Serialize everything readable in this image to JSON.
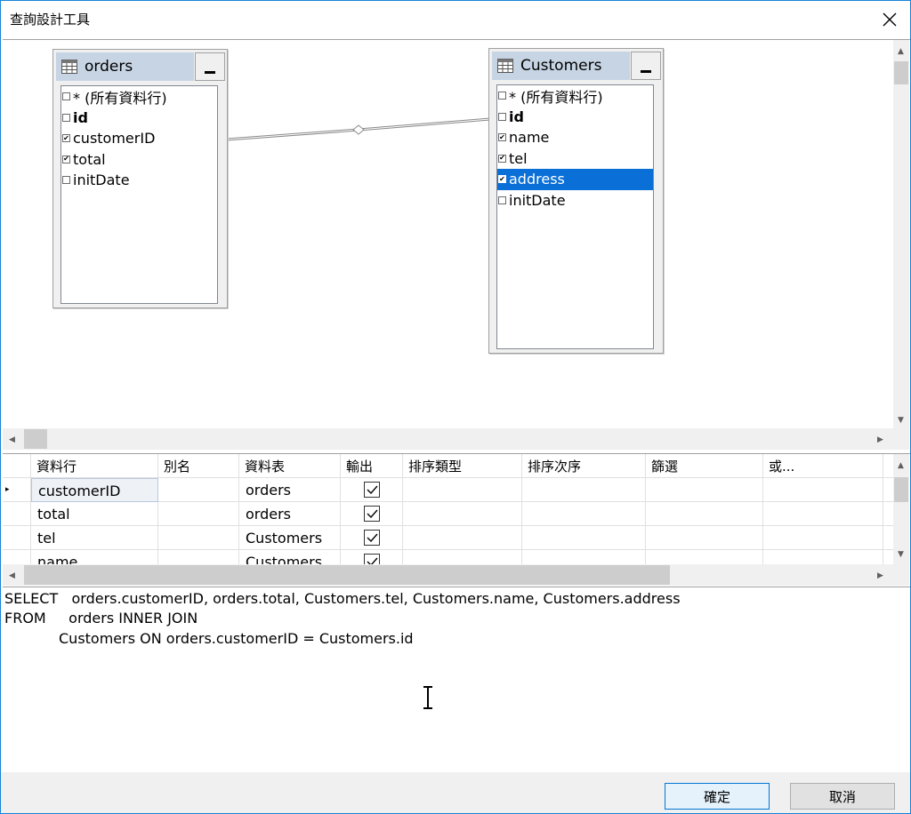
{
  "window": {
    "title": "查詢設計工具"
  },
  "diagram": {
    "tables": [
      {
        "name": "orders",
        "columns": [
          {
            "label": "* (所有資料行)",
            "checked": false,
            "bold": false
          },
          {
            "label": "id",
            "checked": false,
            "bold": true
          },
          {
            "label": "customerID",
            "checked": true,
            "bold": false
          },
          {
            "label": "total",
            "checked": true,
            "bold": false
          },
          {
            "label": "initDate",
            "checked": false,
            "bold": false
          }
        ]
      },
      {
        "name": "Customers",
        "columns": [
          {
            "label": "* (所有資料行)",
            "checked": false,
            "bold": false
          },
          {
            "label": "id",
            "checked": false,
            "bold": true
          },
          {
            "label": "name",
            "checked": true,
            "bold": false
          },
          {
            "label": "tel",
            "checked": true,
            "bold": false
          },
          {
            "label": "address",
            "checked": true,
            "bold": false,
            "selected": true
          },
          {
            "label": "initDate",
            "checked": false,
            "bold": false
          }
        ]
      }
    ]
  },
  "grid": {
    "headers": [
      "資料行",
      "別名",
      "資料表",
      "輸出",
      "排序類型",
      "排序次序",
      "篩選",
      "或..."
    ],
    "rows": [
      {
        "column": "customerID",
        "alias": "",
        "table": "orders",
        "output": true
      },
      {
        "column": "total",
        "alias": "",
        "table": "orders",
        "output": true
      },
      {
        "column": "tel",
        "alias": "",
        "table": "Customers",
        "output": true
      },
      {
        "column": "name",
        "alias": "",
        "table": "Customers",
        "output": true
      }
    ]
  },
  "sql": {
    "line1": "SELECT   orders.customerID, orders.total, Customers.tel, Customers.name, Customers.address",
    "line2": "FROM     orders INNER JOIN",
    "line3": "Customers ON orders.customerID = Customers.id"
  },
  "buttons": {
    "ok": "確定",
    "cancel": "取消"
  },
  "icons": {
    "close": "close-icon",
    "table": "table-icon",
    "text_cursor": "text-cursor-icon"
  }
}
